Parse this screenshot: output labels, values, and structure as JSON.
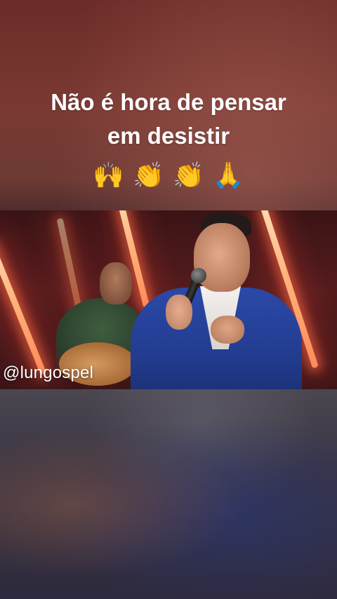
{
  "caption": {
    "line1": "Não é hora de pensar",
    "line2": "em desistir",
    "emojis": [
      "🙌",
      "👏",
      "👏",
      "🙏"
    ]
  },
  "watermark": "@lungospel",
  "colors": {
    "caption_text": "#ffffff",
    "background_top": "#6b2b27",
    "background_bottom": "#2a2540"
  },
  "video": {
    "scene": "stage",
    "icons": [
      "microphone-icon",
      "guitar-icon"
    ]
  }
}
